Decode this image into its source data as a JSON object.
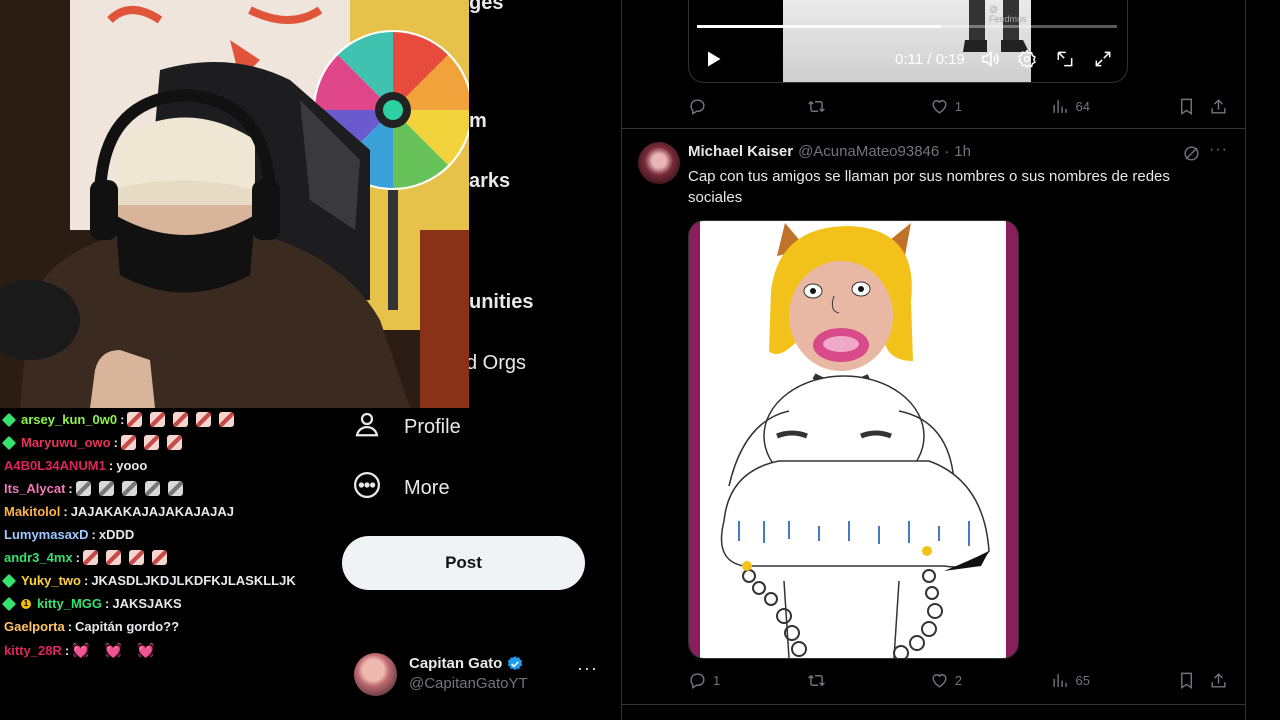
{
  "nav": {
    "frag_messages": "ges",
    "frag_premium": "m",
    "frag_bookmarks": "arks",
    "frag_communities": "unities",
    "frag_orgs": "d Orgs",
    "profile_label": "Profile",
    "more_label": "More",
    "post_label": "Post"
  },
  "account": {
    "display_name": "Capitan Gato",
    "handle": "@CapitanGatoYT",
    "more_glyph": "···"
  },
  "video": {
    "time": "0:11 / 0:19",
    "progress": 0.58,
    "watermark": "@ Feedmus"
  },
  "tweet1_actions": {
    "replies": "",
    "reposts": "",
    "likes": "1",
    "views": "64"
  },
  "tweet2": {
    "name": "Michael Kaiser",
    "handle": "@AcunaMateo93846",
    "sep": "·",
    "time": "1h",
    "text": "Cap con tus amigos se llaman por sus nombres o sus nombres de redes sociales",
    "more_glyph": "···",
    "actions": {
      "replies": "1",
      "reposts": "",
      "likes": "2",
      "views": "65"
    }
  },
  "chat": [
    {
      "user": "arsey_kun_0w0",
      "color": "#8cf24e",
      "badge": "green",
      "text": "",
      "emotes": 5,
      "emote_style": "red"
    },
    {
      "user": "Maryuwu_owo",
      "color": "#e8325d",
      "badge": "green",
      "text": "",
      "emotes": 3,
      "emote_style": "red"
    },
    {
      "user": "A4B0L34ANUM1",
      "color": "#e0245e",
      "badge": "",
      "text": "yooo",
      "emotes": 0
    },
    {
      "user": "Its_Alycat",
      "color": "#f07ab8",
      "badge": "",
      "text": "",
      "emotes": 5,
      "emote_style": "gray"
    },
    {
      "user": "Makitolol",
      "color": "#ffb347",
      "badge": "",
      "text": "JAJAKAKAJAJAKAJAJAJ",
      "emotes": 0
    },
    {
      "user": "LumymasaxD",
      "color": "#9ec9ff",
      "badge": "",
      "text": "xDDD",
      "emotes": 0
    },
    {
      "user": "andr3_4mx",
      "color": "#37e26b",
      "badge": "",
      "text": "",
      "emotes": 4,
      "emote_style": "red"
    },
    {
      "user": "Yuky_two",
      "color": "#ffd23d",
      "badge": "green",
      "text": "JKASDLJKDJLKDFKJLASKLLJK",
      "emotes": 0
    },
    {
      "user": "kitty_MGG",
      "color": "#37e26b",
      "badge": "green-gold",
      "text": "JAKSJAKS",
      "emotes": 0
    },
    {
      "user": "Gaelporta",
      "color": "#ffc46b",
      "badge": "",
      "text": "Capitán gordo??",
      "emotes": 0
    },
    {
      "user": "kitty_28R",
      "color": "#e0245e",
      "badge": "",
      "text": "",
      "emotes": 3,
      "emote_style": "pink"
    }
  ],
  "colors": {
    "bg": "#000000",
    "border": "#2f3336",
    "muted": "#71767b",
    "text": "#e7e9ea",
    "post_btn": "#eff3f4",
    "verified": "#1d9bf0",
    "tweet_img_border": "#8a1f5e"
  },
  "icons": [
    "profile-icon",
    "more-circle-icon",
    "play-icon",
    "volume-icon",
    "settings-icon",
    "pip-icon",
    "fullscreen-icon",
    "reply-icon",
    "repost-icon",
    "like-icon",
    "views-icon",
    "bookmark-icon",
    "share-icon",
    "grok-icon",
    "verified-icon"
  ]
}
